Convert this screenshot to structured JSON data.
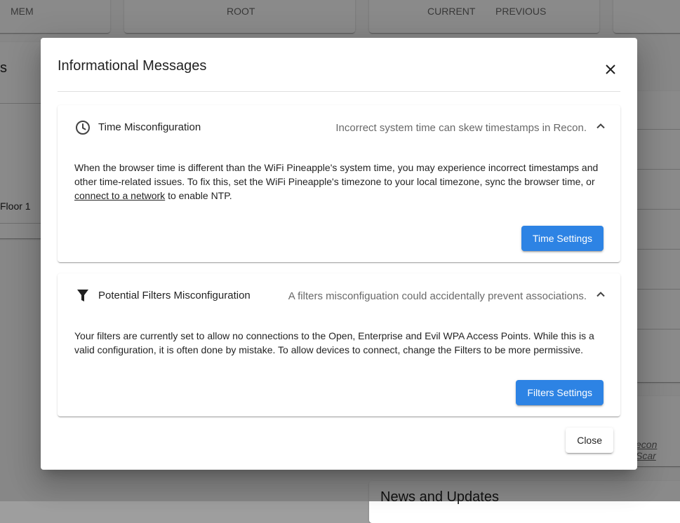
{
  "background": {
    "col_mem": "MEM",
    "col_root": "ROOT",
    "col_current": "CURRENT",
    "col_previous": "PREVIOUS",
    "frag_s": "s",
    "frag_floor": "Floor 1",
    "frag_recon": "econ Scar",
    "news_title": "News and Updates"
  },
  "dialog": {
    "title": "Informational Messages",
    "close_icon": "close-icon",
    "close_label": "Close",
    "panels": [
      {
        "icon": "clock-icon",
        "title": "Time Misconfiguration",
        "subtitle": "Incorrect system time can skew timestamps in Recon.",
        "body_before": "When the browser time is different than the WiFi Pineapple's system time, you may experience incorrect timestamps and other time-related issues. To fix this, set the WiFi Pineapple's timezone to your local timezone, sync the browser time, or ",
        "link": "connect to a network",
        "body_after": " to enable NTP.",
        "button": "Time Settings"
      },
      {
        "icon": "filter-icon",
        "title": "Potential Filters Misconfiguration",
        "subtitle": "A filters misconfiguation could accidentally prevent associations.",
        "body": "Your filters are currently set to allow no connections to the Open, Enterprise and Evil WPA Access Points. While this is a valid configuration, it is often done by mistake. To allow devices to connect, change the Filters to be more permissive.",
        "button": "Filters Settings"
      }
    ]
  }
}
